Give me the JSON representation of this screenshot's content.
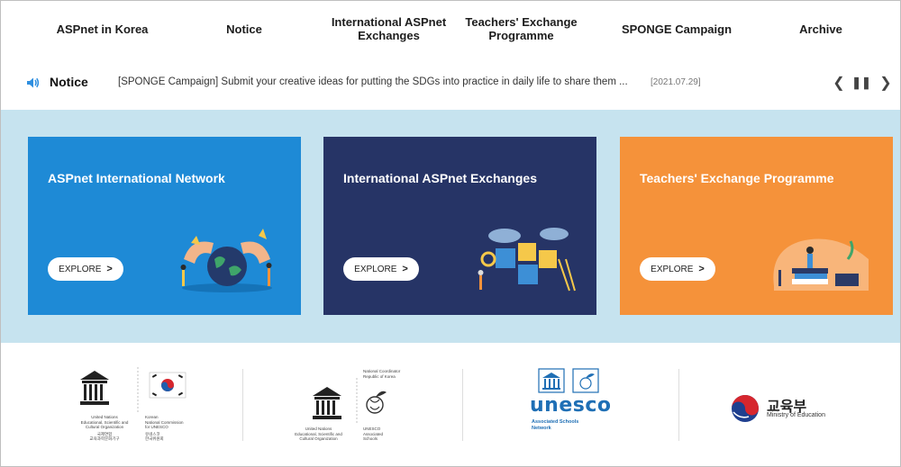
{
  "nav": {
    "items": [
      {
        "label": "ASPnet in Korea"
      },
      {
        "label": "Notice"
      },
      {
        "label": "International ASPnet Exchanges"
      },
      {
        "label": "Teachers' Exchange Programme"
      },
      {
        "label": "SPONGE Campaign"
      },
      {
        "label": "Archive"
      }
    ]
  },
  "notice": {
    "title": "Notice",
    "text": "[SPONGE Campaign] Submit your creative ideas for putting the SDGs into practice in daily life to share them ...",
    "date": "[2021.07.29]",
    "prev_icon": "chevron-left-icon",
    "pause_icon": "pause-icon",
    "next_icon": "chevron-right-icon"
  },
  "cards": [
    {
      "title": "ASPnet International Network",
      "button": "EXPLORE",
      "color": "#1e8ad6"
    },
    {
      "title": "International ASPnet Exchanges",
      "button": "EXPLORE",
      "color": "#263466"
    },
    {
      "title": "Teachers' Exchange Programme",
      "button": "EXPLORE",
      "color": "#f5923a"
    }
  ],
  "logos": {
    "unesco_korea": {
      "left_lines": [
        "United Nations",
        "Educational, Scientific and",
        "Cultural Organization",
        "국제연합",
        "교육과학문화기구"
      ],
      "right_lines": [
        "Korean",
        "National Commission",
        "for UNESCO",
        "유네스코",
        "한국위원회"
      ]
    },
    "aspnet_korea": {
      "top_lines": [
        "National Coordinator",
        "Republic of Korea"
      ],
      "left_lines": [
        "United Nations",
        "Educational, Scientific and",
        "Cultural Organization"
      ],
      "right_lines": [
        "UNESCO",
        "Associated",
        "Schools"
      ]
    },
    "unesco_asp": {
      "wordmark": "unesco",
      "sub_lines": [
        "Associated Schools",
        "Network"
      ]
    },
    "moe": {
      "korean": "교육부",
      "english": "Ministry of Education"
    }
  },
  "colors": {
    "band": "#c6e3ef",
    "unesco_blue": "#1f6fb5",
    "notice_icon": "#2f8fe0"
  }
}
